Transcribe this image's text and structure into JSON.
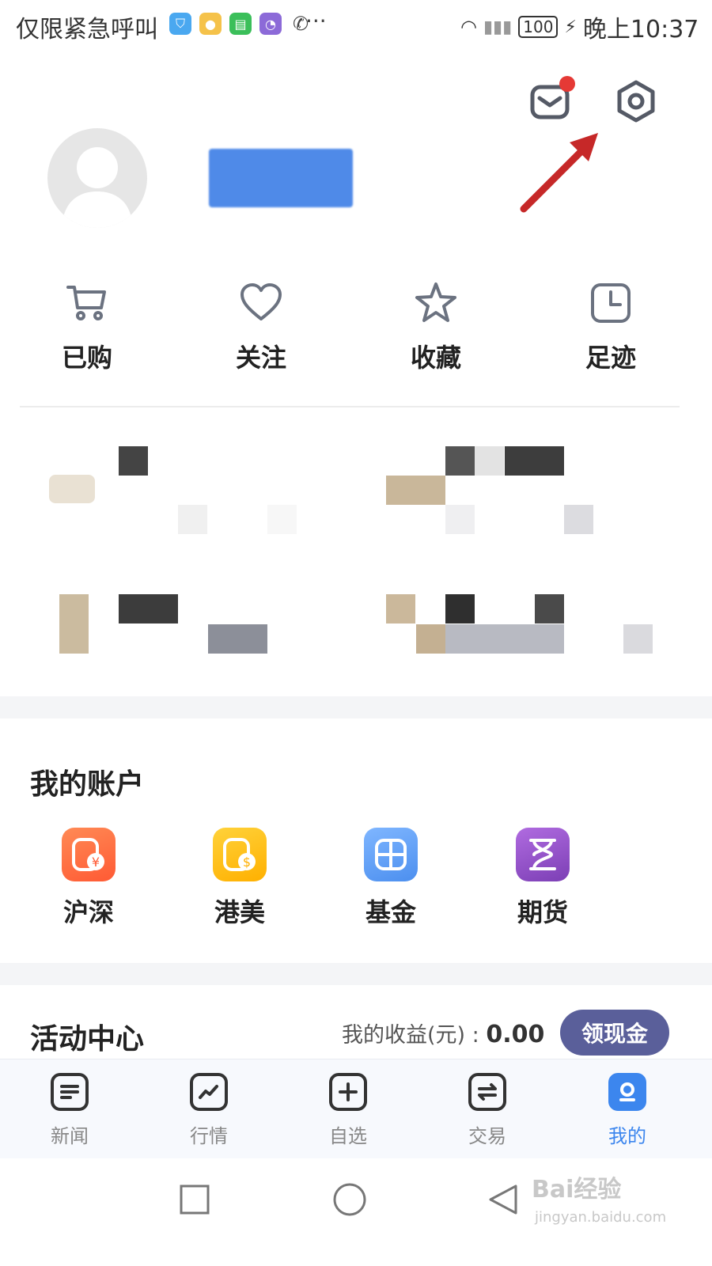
{
  "status_bar": {
    "carrier_text": "仅限紧急呼叫",
    "time": "晚上10:37",
    "battery": "100",
    "more": "···",
    "app_icons": [
      "shield-app-icon",
      "lottery-app-icon",
      "book-app-icon",
      "chart-app-icon",
      "wechat-icon"
    ]
  },
  "header": {
    "notification_badge": true
  },
  "quick_actions": [
    {
      "label": "已购",
      "icon": "cart-icon"
    },
    {
      "label": "关注",
      "icon": "heart-icon"
    },
    {
      "label": "收藏",
      "icon": "star-icon"
    },
    {
      "label": "足迹",
      "icon": "clock-icon"
    }
  ],
  "accounts": {
    "title": "我的账户",
    "items": [
      {
        "label": "沪深",
        "icon": "yuan-card-icon",
        "color": "#ff6a3d"
      },
      {
        "label": "港美",
        "icon": "dollar-card-icon",
        "color": "#ffc01e"
      },
      {
        "label": "基金",
        "icon": "grid-icon",
        "color": "#6aa8f5"
      },
      {
        "label": "期货",
        "icon": "hourglass-icon",
        "color": "#9c57c9"
      }
    ]
  },
  "activity": {
    "title": "活动中心",
    "earnings_label": "我的收益(元) : ",
    "earnings_value": "0.00",
    "cash_button": "领现金"
  },
  "tabs": [
    {
      "label": "新闻",
      "icon": "news-icon",
      "active": false
    },
    {
      "label": "行情",
      "icon": "market-icon",
      "active": false
    },
    {
      "label": "自选",
      "icon": "add-icon",
      "active": false
    },
    {
      "label": "交易",
      "icon": "trade-icon",
      "active": false
    },
    {
      "label": "我的",
      "icon": "profile-icon",
      "active": true
    }
  ],
  "watermark": {
    "main": "Bai经验",
    "sub": "jingyan.baidu.com"
  },
  "colors": {
    "accent": "#3c86ee",
    "cash_button": "#5a5f9a",
    "arrow": "#c62828"
  }
}
